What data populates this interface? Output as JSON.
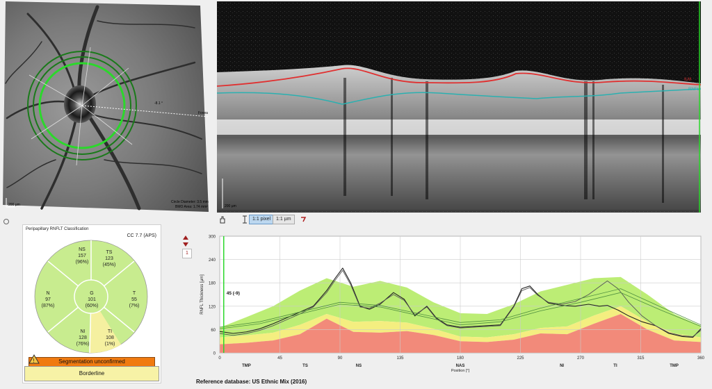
{
  "fundus": {
    "scale_bar": "200 µm",
    "fovea_label": "Fovea",
    "angle_label": "-8.1 °",
    "circle_diameter": "Circle Diameter: 3.5 mm",
    "bmo_area": "BMO Area: 1.74 mm²"
  },
  "bscan": {
    "scale_bar": "200 µm",
    "ilm_label": "ILM",
    "rnfl_label": "RNFL",
    "ilm_color": "#e03030",
    "rnfl_color": "#2ab0b0"
  },
  "toolbar": {
    "pixel_label": "1:1 pixel",
    "micron_label": "1:1 µm"
  },
  "classification": {
    "title": "Peripapillary RNFLT Classification",
    "version": "CC 7.7 (APS)",
    "colors": {
      "normal": "#c8ec8f",
      "borderline": "#f5f0a0",
      "outside": "#f28a7a"
    },
    "sectors": [
      {
        "name": "NS",
        "value": "157",
        "pct": "(96%)"
      },
      {
        "name": "TS",
        "value": "123",
        "pct": "(45%)"
      },
      {
        "name": "N",
        "value": "97",
        "pct": "(87%)"
      },
      {
        "name": "G",
        "value": "101",
        "pct": "(60%)"
      },
      {
        "name": "T",
        "value": "55",
        "pct": "(7%)"
      },
      {
        "name": "NI",
        "value": "128",
        "pct": "(76%)"
      },
      {
        "name": "TI",
        "value": "108",
        "pct": "(1%)"
      }
    ],
    "warning": "Segmentation unconfirmed",
    "status": "Borderline"
  },
  "side_panel": {
    "page_number": "1"
  },
  "chart_data": {
    "type": "line",
    "ylabel": "RNFL Thickness [µm]",
    "xlabel": "Position [°]",
    "xlim": [
      0,
      360
    ],
    "ylim": [
      0,
      300
    ],
    "yticks": [
      0,
      60,
      120,
      180,
      240,
      300
    ],
    "xticks": [
      0,
      45,
      90,
      135,
      180,
      225,
      270,
      315,
      360
    ],
    "sector_labels": [
      {
        "x": 20,
        "label": "TMP"
      },
      {
        "x": 64,
        "label": "TS"
      },
      {
        "x": 104,
        "label": "NS"
      },
      {
        "x": 180,
        "label": "NAS"
      },
      {
        "x": 256,
        "label": "NI"
      },
      {
        "x": 296,
        "label": "TI"
      },
      {
        "x": 340,
        "label": "TMP"
      }
    ],
    "cursor": {
      "x": 3,
      "label": "45 (-9)"
    },
    "band_x": [
      0,
      20,
      40,
      60,
      80,
      100,
      120,
      140,
      160,
      180,
      200,
      220,
      240,
      260,
      280,
      300,
      320,
      340,
      360
    ],
    "band_red": [
      22,
      26,
      32,
      48,
      88,
      54,
      52,
      56,
      46,
      30,
      28,
      34,
      50,
      48,
      75,
      100,
      60,
      32,
      28
    ],
    "band_yellow": [
      40,
      45,
      52,
      72,
      100,
      80,
      82,
      78,
      62,
      42,
      40,
      48,
      64,
      68,
      96,
      120,
      80,
      50,
      40
    ],
    "band_green_top": [
      65,
      92,
      120,
      160,
      192,
      170,
      185,
      168,
      130,
      102,
      100,
      125,
      158,
      175,
      192,
      195,
      150,
      100,
      70
    ],
    "series": [
      {
        "x": [
          0,
          10,
          20,
          30,
          40,
          50,
          60,
          70,
          80,
          86,
          92,
          98,
          105,
          112,
          120,
          130,
          138,
          146,
          155,
          162,
          170,
          180,
          190,
          200,
          210,
          220,
          226,
          232,
          238,
          246,
          256,
          266,
          276,
          284,
          290,
          298,
          306,
          316,
          326,
          336,
          346,
          354,
          360
        ],
        "values": [
          55,
          50,
          54,
          62,
          75,
          90,
          105,
          120,
          160,
          190,
          218,
          180,
          120,
          112,
          125,
          155,
          138,
          95,
          120,
          90,
          72,
          66,
          68,
          70,
          72,
          120,
          165,
          172,
          150,
          128,
          122,
          120,
          125,
          120,
          122,
          110,
          95,
          80,
          70,
          50,
          42,
          40,
          62
        ]
      },
      {
        "x": [
          0,
          10,
          20,
          30,
          40,
          50,
          60,
          70,
          80,
          86,
          92,
          98,
          105,
          112,
          120,
          130,
          138,
          146,
          155,
          162,
          170,
          180,
          190,
          200,
          210,
          220,
          226,
          232,
          238,
          246,
          256,
          266,
          276,
          284,
          290,
          298,
          306,
          316,
          326,
          336,
          346,
          354,
          360
        ],
        "values": [
          50,
          45,
          50,
          58,
          70,
          85,
          100,
          118,
          155,
          185,
          212,
          175,
          118,
          115,
          128,
          150,
          135,
          98,
          118,
          88,
          70,
          64,
          66,
          68,
          70,
          118,
          160,
          168,
          148,
          130,
          125,
          132,
          150,
          170,
          185,
          165,
          130,
          95,
          70,
          52,
          44,
          42,
          58
        ]
      },
      {
        "x": [
          0,
          30,
          60,
          90,
          120,
          150,
          180,
          210,
          240,
          270,
          300,
          330,
          360
        ],
        "values": [
          62,
          75,
          100,
          125,
          118,
          95,
          72,
          80,
          108,
          130,
          155,
          110,
          68
        ]
      },
      {
        "x": [
          0,
          30,
          60,
          90,
          120,
          150,
          180,
          210,
          240,
          270,
          300,
          330,
          360
        ],
        "values": [
          66,
          80,
          105,
          130,
          122,
          100,
          78,
          85,
          115,
          140,
          165,
          118,
          72
        ]
      }
    ]
  },
  "reference": "Reference database: US Ethnic Mix (2016)"
}
